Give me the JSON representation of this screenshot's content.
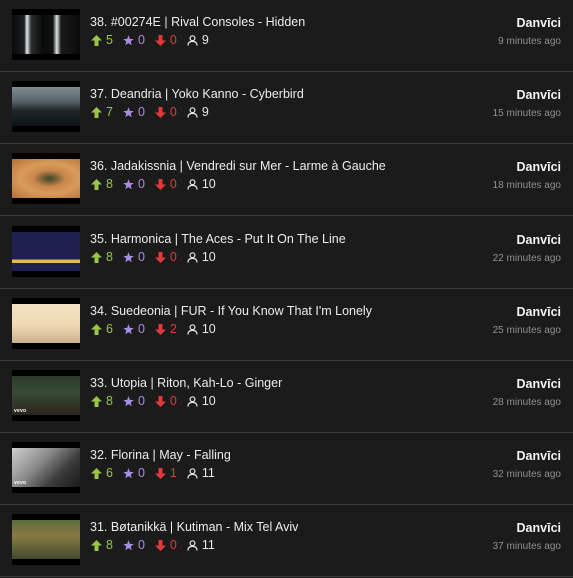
{
  "colors": {
    "background": "#1b1b1b",
    "upvote": "#9ac44a",
    "star": "#a98be8",
    "downvote": "#e03a3a",
    "divider": "#3a3a3a",
    "muted_text": "#8f8f8f"
  },
  "icons": {
    "up": "arrow-up-icon",
    "star": "star-icon",
    "down": "arrow-down-icon",
    "user": "user-icon"
  },
  "items": [
    {
      "title": "38. #00274E | Rival Consoles - Hidden",
      "up": "5",
      "star": "0",
      "down": "0",
      "users": "9",
      "author": "Danvīci",
      "time": "9 minutes ago",
      "thumb": "hidden",
      "vevo": ""
    },
    {
      "title": "37. Deandria | Yoko Kanno - Cyberbird",
      "up": "7",
      "star": "0",
      "down": "0",
      "users": "9",
      "author": "Danvīci",
      "time": "15 minutes ago",
      "thumb": "cyber",
      "vevo": ""
    },
    {
      "title": "36. Jadakissnia | Vendredi sur Mer - Larme à Gauche",
      "up": "8",
      "star": "0",
      "down": "0",
      "users": "10",
      "author": "Danvīci",
      "time": "18 minutes ago",
      "thumb": "larme",
      "vevo": ""
    },
    {
      "title": "35. Harmonica | The Aces - Put It On The Line",
      "up": "8",
      "star": "0",
      "down": "0",
      "users": "10",
      "author": "Danvīci",
      "time": "22 minutes ago",
      "thumb": "putit",
      "vevo": ""
    },
    {
      "title": "34. Suedeonia | FUR - If You Know That I'm Lonely",
      "up": "6",
      "star": "0",
      "down": "2",
      "users": "10",
      "author": "Danvīci",
      "time": "25 minutes ago",
      "thumb": "fur",
      "vevo": ""
    },
    {
      "title": "33. Utopia | Riton, Kah-Lo - Ginger",
      "up": "8",
      "star": "0",
      "down": "0",
      "users": "10",
      "author": "Danvīci",
      "time": "28 minutes ago",
      "thumb": "ginger",
      "vevo": "vevo"
    },
    {
      "title": "32. Florina | May - Falling",
      "up": "6",
      "star": "0",
      "down": "1",
      "users": "11",
      "author": "Danvīci",
      "time": "32 minutes ago",
      "thumb": "falling",
      "vevo": "vevo"
    },
    {
      "title": "31. Bøtanikkä | Kutiman - Mix Tel Aviv",
      "up": "8",
      "star": "0",
      "down": "0",
      "users": "11",
      "author": "Danvīci",
      "time": "37 minutes ago",
      "thumb": "mix",
      "vevo": ""
    }
  ]
}
